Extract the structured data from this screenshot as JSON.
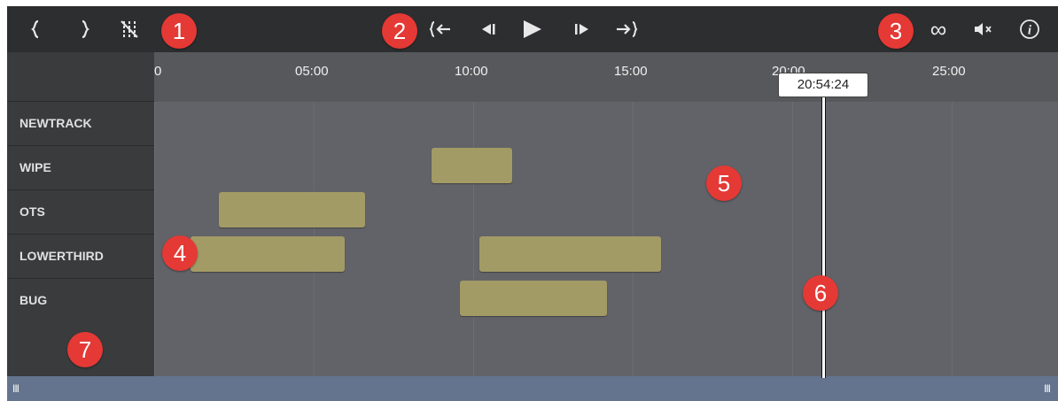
{
  "toolbar": {
    "left_icons": [
      "brace-left-icon",
      "brace-right-icon",
      "hide-track-icon"
    ],
    "center_icons": [
      "rewind-to-start-icon",
      "step-back-icon",
      "play-icon",
      "step-forward-icon",
      "forward-to-end-icon"
    ],
    "right_icons": [
      "loop-icon",
      "mute-icon",
      "info-icon"
    ],
    "loop_glyph": "∞",
    "info_glyph": "i"
  },
  "ruler": {
    "ticks": [
      "0",
      "05:00",
      "10:00",
      "15:00",
      "20:00",
      "25:00"
    ]
  },
  "playhead": {
    "time": "20:54:24"
  },
  "tracks": [
    "NEWTRACK",
    "WIPE",
    "OTS",
    "LOWERTHIRD",
    "BUG"
  ],
  "clips": [
    {
      "track": "WIPE",
      "start": "08:47",
      "end": "11:19"
    },
    {
      "track": "OTS",
      "start": "02:01",
      "end": "06:37"
    },
    {
      "track": "LOWERTHIRD",
      "start": "01:08",
      "end": "05:57"
    },
    {
      "track": "LOWERTHIRD",
      "start": "10:14",
      "end": "15:56"
    },
    {
      "track": "BUG",
      "start": "09:37",
      "end": "14:14"
    }
  ],
  "callouts": [
    "1",
    "2",
    "3",
    "4",
    "5",
    "6",
    "7"
  ],
  "colors": {
    "toolbar_bg": "#2d2e30",
    "timeline_bg": "#626368",
    "clip_fill": "#a39b66",
    "callout_red": "#e53935",
    "scrollbar": "#64748e"
  },
  "scrollbar": {
    "grip_left": "III",
    "grip_right": "III"
  }
}
